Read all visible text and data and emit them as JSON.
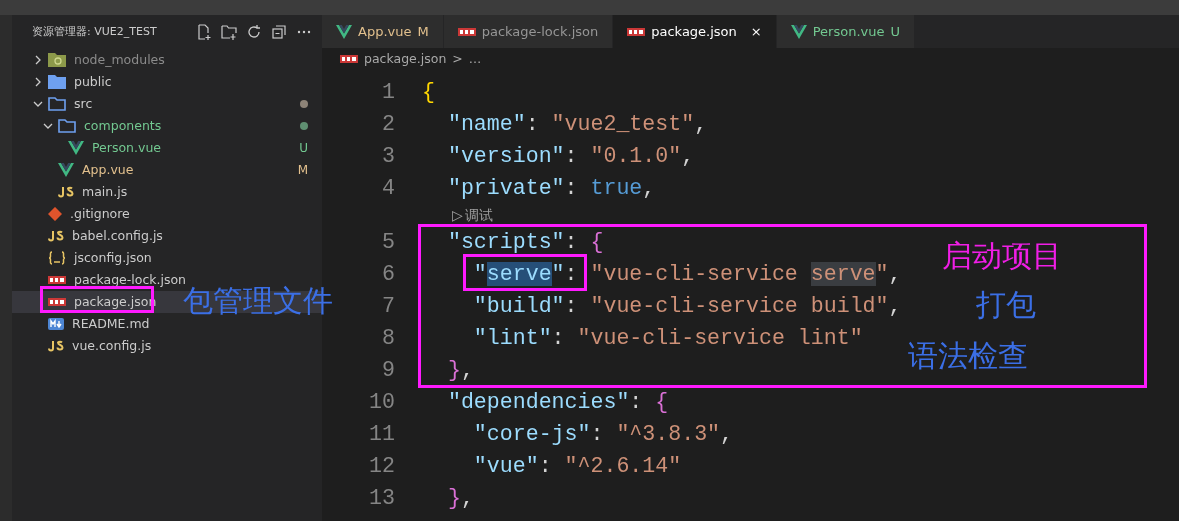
{
  "explorer": {
    "title": "资源管理器: VUE2_TEST",
    "items": [
      {
        "label": "node_modules",
        "kind": "node-folder",
        "expanded": false,
        "color": "#8b8b8b",
        "selected": false
      },
      {
        "label": "public",
        "kind": "folder",
        "expanded": false,
        "selected": false
      },
      {
        "label": "src",
        "kind": "folder",
        "expanded": true,
        "dot": {
          "color": "#8d8377"
        },
        "selected": false,
        "children": [
          {
            "label": "components",
            "kind": "folder",
            "expanded": true,
            "color": "#73c991",
            "dot": {
              "color": "#5f8f71"
            },
            "selected": false,
            "children": [
              {
                "label": "Person.vue",
                "kind": "vue",
                "color": "#73c991",
                "badge": "U",
                "selected": false
              }
            ]
          },
          {
            "label": "App.vue",
            "kind": "vue",
            "color": "#e2c08d",
            "badge": "M",
            "selected": false
          },
          {
            "label": "main.js",
            "kind": "js",
            "selected": false
          }
        ]
      },
      {
        "label": ".gitignore",
        "kind": "git",
        "selected": false
      },
      {
        "label": "babel.config.js",
        "kind": "js",
        "selected": false
      },
      {
        "label": "jsconfig.json",
        "kind": "json",
        "selected": false
      },
      {
        "label": "package-lock.json",
        "kind": "npm",
        "selected": false
      },
      {
        "label": "package.json",
        "kind": "npm",
        "selected": true
      },
      {
        "label": "README.md",
        "kind": "md",
        "selected": false
      },
      {
        "label": "vue.config.js",
        "kind": "js",
        "selected": false
      }
    ]
  },
  "tabs": [
    {
      "label": "App.vue",
      "kind": "vue",
      "color": "#e2c08d",
      "badge": "M",
      "selected": false
    },
    {
      "label": "package-lock.json",
      "kind": "npm",
      "selected": false
    },
    {
      "label": "package.json",
      "kind": "npm",
      "selected": true,
      "close": "×"
    },
    {
      "label": "Person.vue",
      "kind": "vue",
      "color": "#73c991",
      "badge": "U",
      "selected": false
    }
  ],
  "breadcrumb": {
    "file": "package.json",
    "separator": ">",
    "more": "…"
  },
  "editor": {
    "lines": [
      {
        "kind": "code",
        "number": "1",
        "tokens": [
          {
            "kind": "brace1",
            "text": "{"
          }
        ]
      },
      {
        "kind": "code",
        "number": "2",
        "tokens": [
          {
            "kind": "key",
            "text": "  \"name\""
          },
          {
            "kind": "punct",
            "text": ": "
          },
          {
            "kind": "string",
            "text": "\"vue2_test\""
          },
          {
            "kind": "punct",
            "text": ","
          }
        ]
      },
      {
        "kind": "code",
        "number": "3",
        "tokens": [
          {
            "kind": "key",
            "text": "  \"version\""
          },
          {
            "kind": "punct",
            "text": ": "
          },
          {
            "kind": "string",
            "text": "\"0.1.0\""
          },
          {
            "kind": "punct",
            "text": ","
          }
        ]
      },
      {
        "kind": "code",
        "number": "4",
        "tokens": [
          {
            "kind": "key",
            "text": "  \"private\""
          },
          {
            "kind": "punct",
            "text": ": "
          },
          {
            "kind": "bool",
            "text": "true"
          },
          {
            "kind": "punct",
            "text": ","
          }
        ]
      },
      {
        "kind": "codelens",
        "glyph": "▷",
        "text": "调试"
      },
      {
        "kind": "code",
        "number": "5",
        "tokens": [
          {
            "kind": "key",
            "text": "  \"scripts\""
          },
          {
            "kind": "punct",
            "text": ": "
          },
          {
            "kind": "brace2",
            "text": "{"
          }
        ]
      },
      {
        "kind": "code",
        "number": "6",
        "tokens": [
          {
            "kind": "key",
            "text": "    \"",
            "selected": false,
            "highlighted": false
          },
          {
            "kind": "key",
            "text": "serve",
            "selected": true,
            "highlighted": false
          },
          {
            "kind": "key",
            "text": "\"",
            "selected": false,
            "highlighted": false
          },
          {
            "kind": "punct",
            "text": ": ",
            "selected": false,
            "highlighted": false
          },
          {
            "kind": "string",
            "text": "\"vue-cli-service ",
            "selected": false,
            "highlighted": false
          },
          {
            "kind": "string",
            "text": "serve",
            "selected": false,
            "highlighted": true
          },
          {
            "kind": "string",
            "text": "\"",
            "selected": false,
            "highlighted": false
          },
          {
            "kind": "punct",
            "text": ",",
            "selected": false,
            "highlighted": false
          }
        ]
      },
      {
        "kind": "code",
        "number": "7",
        "tokens": [
          {
            "kind": "key",
            "text": "    \"build\""
          },
          {
            "kind": "punct",
            "text": ": "
          },
          {
            "kind": "string",
            "text": "\"vue-cli-service build\""
          },
          {
            "kind": "punct",
            "text": ","
          }
        ]
      },
      {
        "kind": "code",
        "number": "8",
        "tokens": [
          {
            "kind": "key",
            "text": "    \"lint\""
          },
          {
            "kind": "punct",
            "text": ": "
          },
          {
            "kind": "string",
            "text": "\"vue-cli-service lint\""
          }
        ]
      },
      {
        "kind": "code",
        "number": "9",
        "tokens": [
          {
            "kind": "brace2",
            "text": "  }"
          },
          {
            "kind": "punct",
            "text": ","
          }
        ]
      },
      {
        "kind": "code",
        "number": "10",
        "tokens": [
          {
            "kind": "key",
            "text": "  \"dependencies\""
          },
          {
            "kind": "punct",
            "text": ": "
          },
          {
            "kind": "brace2",
            "text": "{"
          }
        ]
      },
      {
        "kind": "code",
        "number": "11",
        "tokens": [
          {
            "kind": "key",
            "text": "    \"core-js\""
          },
          {
            "kind": "punct",
            "text": ": "
          },
          {
            "kind": "string",
            "text": "\"^3.8.3\""
          },
          {
            "kind": "punct",
            "text": ","
          }
        ]
      },
      {
        "kind": "code",
        "number": "12",
        "tokens": [
          {
            "kind": "key",
            "text": "    \"vue\""
          },
          {
            "kind": "punct",
            "text": ": "
          },
          {
            "kind": "string",
            "text": "\"^2.6.14\""
          }
        ]
      },
      {
        "kind": "code",
        "number": "13",
        "tokens": [
          {
            "kind": "brace2",
            "text": "  }"
          },
          {
            "kind": "punct",
            "text": ","
          }
        ]
      }
    ]
  },
  "annotations": [
    {
      "kind": "box",
      "color": "#ff1aff"
    },
    {
      "kind": "label",
      "text": "包管理文件",
      "color": "#3b6fe6"
    },
    {
      "kind": "box",
      "color": "#ff1aff"
    },
    {
      "kind": "box",
      "color": "#ff1aff"
    },
    {
      "kind": "label",
      "text": "启动项目",
      "color": "#f01ee6"
    },
    {
      "kind": "label",
      "text": "打包",
      "color": "#3b6fe6"
    },
    {
      "kind": "label",
      "text": "语法检查",
      "color": "#3b6fe6"
    }
  ]
}
